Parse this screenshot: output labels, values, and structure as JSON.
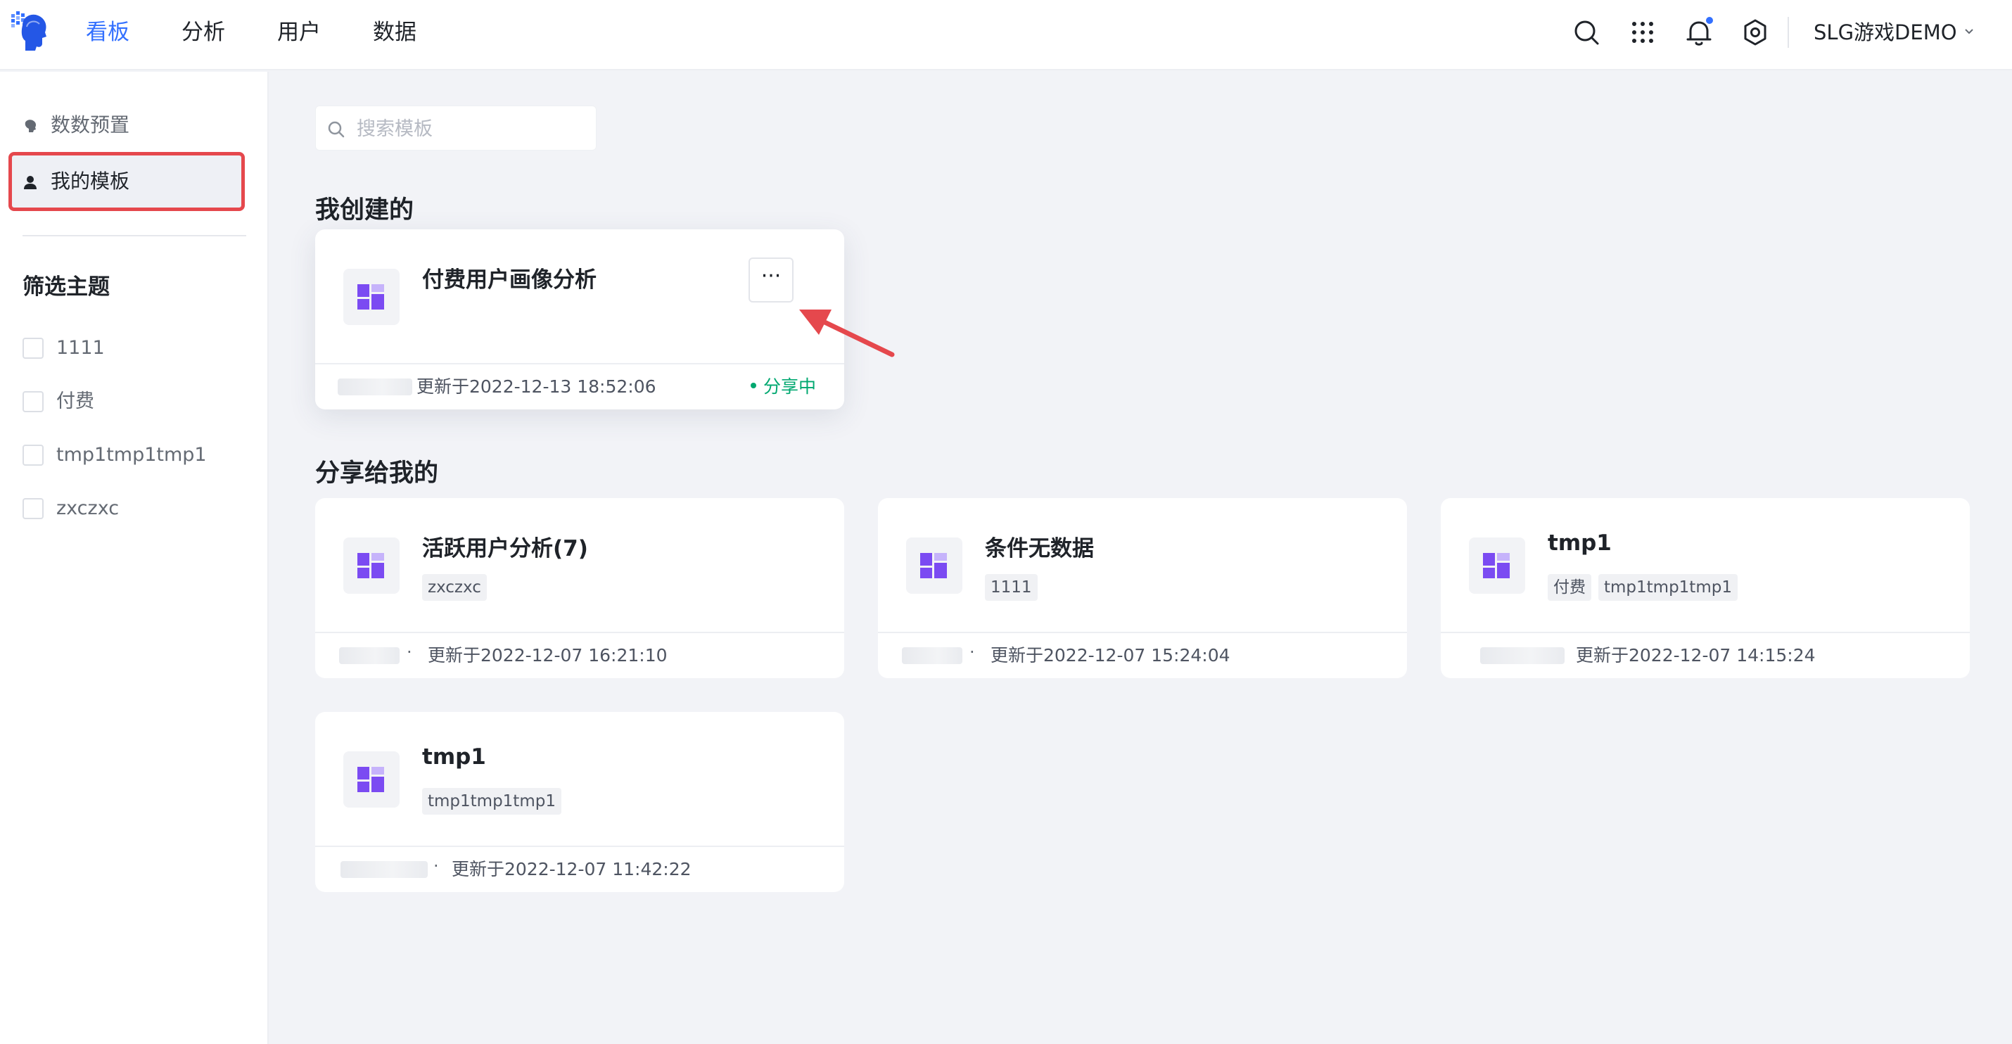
{
  "nav": {
    "items": [
      "看板",
      "分析",
      "用户",
      "数据"
    ],
    "active": "看板"
  },
  "header": {
    "project_name": "SLG游戏DEMO",
    "icons": [
      "search-icon",
      "apps-grid-icon",
      "bell-icon",
      "settings-icon"
    ],
    "notification_dot_color": "#3370ff"
  },
  "sidebar": {
    "items": [
      {
        "label": "数数预置",
        "icon": "preset-icon"
      },
      {
        "label": "我的模板",
        "icon": "user-icon"
      }
    ],
    "active_item": "我的模板",
    "filter_title": "筛选主题",
    "filters": [
      "1111",
      "付费",
      "tmp1tmp1tmp1",
      "zxczxc"
    ]
  },
  "search": {
    "placeholder": "搜索模板"
  },
  "sections": {
    "created_title": "我创建的",
    "shared_title": "分享给我的"
  },
  "created_cards": [
    {
      "title": "付费用户画像分析",
      "updated": "更新于2022-12-13 18:52:06",
      "status": "分享中",
      "more_label": "···"
    }
  ],
  "shared_cards": [
    {
      "title": "活跃用户分析(7)",
      "tags": [
        "zxczxc"
      ],
      "updated": "更新于2022-12-07 16:21:10"
    },
    {
      "title": "条件无数据",
      "tags": [
        "1111"
      ],
      "updated": "更新于2022-12-07 15:24:04"
    },
    {
      "title": "tmp1",
      "tags": [
        "付费",
        "tmp1tmp1tmp1"
      ],
      "updated": "更新于2022-12-07 14:15:24"
    },
    {
      "title": "tmp1",
      "tags": [
        "tmp1tmp1tmp1"
      ],
      "updated": "更新于2022-12-07 11:42:22"
    }
  ],
  "colors": {
    "accent": "#3370ff",
    "highlight_border": "#e5484d",
    "status_green": "#00a870",
    "template_icon_purple": "#7b4bf2"
  }
}
